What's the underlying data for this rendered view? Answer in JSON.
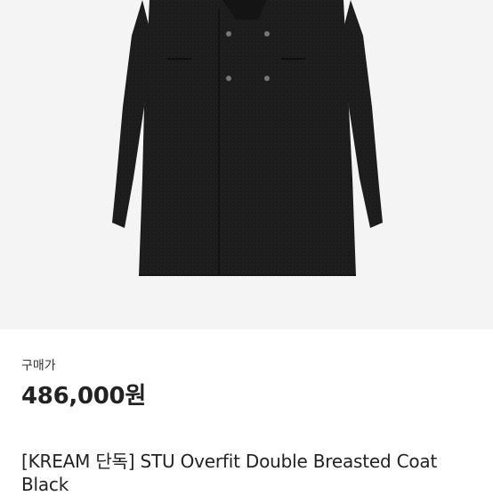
{
  "product": {
    "image_alt": "coat-product-photo",
    "price_label": "구매가",
    "price": "486,000원",
    "title": "[KREAM 단독] STU Overfit Double Breasted Coat Black"
  },
  "colors": {
    "image_background": "#f4f4f4",
    "coat": "#1c1c1c",
    "text": "#222222"
  }
}
